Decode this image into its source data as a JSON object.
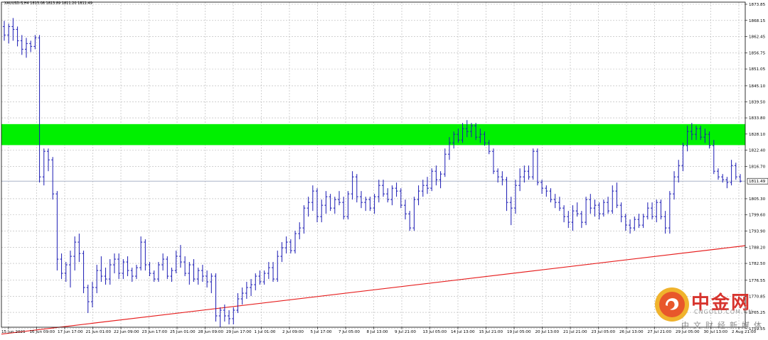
{
  "header": {
    "title": "XAUUSD-S,H4  1813.08 1813.89 1811.20 1811.49"
  },
  "watermark": {
    "brand_cn": "中金网",
    "domain": "CNGOLD.COM.CN",
    "subtitle_cn": "中文财经新媒体"
  },
  "chart_data": {
    "type": "candlestick",
    "symbol": "XAUUSD-S",
    "timeframe": "H4",
    "last_price": "1811.49",
    "y_axis": {
      "side": "right",
      "ylim": [
        1760.0,
        1874.6
      ],
      "tick_values": [
        1873.85,
        1868.15,
        1862.45,
        1856.75,
        1851.05,
        1845.1,
        1839.5,
        1833.8,
        1828.1,
        1822.4,
        1816.7,
        1811.49,
        1805.3,
        1799.6,
        1793.9,
        1788.2,
        1782.5,
        1776.55,
        1770.85,
        1765.25,
        1759.55
      ],
      "tick_labels": [
        "1873.85",
        "1868.15",
        "1862.45",
        "1856.75",
        "1851.05",
        "1845.10",
        "1839.50",
        "1833.80",
        "1828.10",
        "1822.40",
        "1816.70",
        "1811.49",
        "1805.30",
        "1799.60",
        "1793.90",
        "1788.20",
        "1782.50",
        "1776.55",
        "1770.85",
        "1765.25",
        "1759.55"
      ]
    },
    "x_axis": {
      "tick_labels": [
        "15 Jun 2021",
        "16 Jun 09:00",
        "17 Jun 17:00",
        "21 Jun 01:00",
        "22 Jun 09:00",
        "23 Jun 17:00",
        "25 Jun 01:00",
        "28 Jun 09:00",
        "29 Jun 17:00",
        "1 Jul 01:00",
        "2 Jul 09:00",
        "5 Jul 17:00",
        "7 Jul 05:00",
        "8 Jul 13:00",
        "9 Jul 21:00",
        "13 Jul 05:00",
        "14 Jul 13:00",
        "15 Jul 21:00",
        "19 Jul 05:00",
        "20 Jul 13:00",
        "21 Jul 21:00",
        "23 Jul 05:00",
        "26 Jul 13:00",
        "27 Jul 21:00",
        "29 Jul 05:00",
        "30 Jul 13:00",
        "2 Aug 21:00"
      ]
    },
    "grid": true,
    "colors": {
      "candle": "#1a1ab4",
      "grid": "#b4b4b4",
      "zone": "#00f000",
      "trendline": "#e61e1e",
      "price_line": "#aab4c8"
    },
    "resistance_zone": {
      "y_low": 1824.2,
      "y_high": 1831.6
    },
    "trendline": {
      "from": {
        "bar": 0,
        "y": 1757.7
      },
      "to": {
        "bar": 169,
        "y": 1788.9
      }
    },
    "candles": [
      {
        "o": 1866,
        "h": 1868,
        "l": 1861,
        "c": 1863
      },
      {
        "o": 1863,
        "h": 1867,
        "l": 1860,
        "c": 1866
      },
      {
        "o": 1866,
        "h": 1869,
        "l": 1861,
        "c": 1865
      },
      {
        "o": 1865,
        "h": 1866,
        "l": 1859,
        "c": 1861
      },
      {
        "o": 1861,
        "h": 1863,
        "l": 1856,
        "c": 1858
      },
      {
        "o": 1858,
        "h": 1862,
        "l": 1855,
        "c": 1860
      },
      {
        "o": 1860,
        "h": 1861,
        "l": 1857,
        "c": 1859
      },
      {
        "o": 1859,
        "h": 1863,
        "l": 1858,
        "c": 1862
      },
      {
        "o": 1862,
        "h": 1863,
        "l": 1811,
        "c": 1813
      },
      {
        "o": 1813,
        "h": 1823,
        "l": 1810,
        "c": 1822
      },
      {
        "o": 1822,
        "h": 1823,
        "l": 1815,
        "c": 1819
      },
      {
        "o": 1819,
        "h": 1820,
        "l": 1805,
        "c": 1807
      },
      {
        "o": 1807,
        "h": 1808,
        "l": 1780,
        "c": 1784
      },
      {
        "o": 1784,
        "h": 1786,
        "l": 1777,
        "c": 1779
      },
      {
        "o": 1779,
        "h": 1783,
        "l": 1776,
        "c": 1782
      },
      {
        "o": 1782,
        "h": 1787,
        "l": 1774,
        "c": 1785
      },
      {
        "o": 1785,
        "h": 1792,
        "l": 1780,
        "c": 1790
      },
      {
        "o": 1790,
        "h": 1793,
        "l": 1783,
        "c": 1786
      },
      {
        "o": 1786,
        "h": 1787,
        "l": 1772,
        "c": 1774
      },
      {
        "o": 1774,
        "h": 1775,
        "l": 1765,
        "c": 1769
      },
      {
        "o": 1769,
        "h": 1776,
        "l": 1767,
        "c": 1774
      },
      {
        "o": 1774,
        "h": 1782,
        "l": 1772,
        "c": 1780
      },
      {
        "o": 1780,
        "h": 1785,
        "l": 1776,
        "c": 1778
      },
      {
        "o": 1778,
        "h": 1781,
        "l": 1775,
        "c": 1777
      },
      {
        "o": 1777,
        "h": 1784,
        "l": 1775,
        "c": 1782
      },
      {
        "o": 1782,
        "h": 1786,
        "l": 1779,
        "c": 1784
      },
      {
        "o": 1784,
        "h": 1786,
        "l": 1777,
        "c": 1779
      },
      {
        "o": 1779,
        "h": 1784,
        "l": 1777,
        "c": 1783
      },
      {
        "o": 1783,
        "h": 1785,
        "l": 1778,
        "c": 1780
      },
      {
        "o": 1780,
        "h": 1781,
        "l": 1776,
        "c": 1778
      },
      {
        "o": 1778,
        "h": 1782,
        "l": 1777,
        "c": 1781
      },
      {
        "o": 1781,
        "h": 1792,
        "l": 1780,
        "c": 1790
      },
      {
        "o": 1790,
        "h": 1791,
        "l": 1780,
        "c": 1782
      },
      {
        "o": 1782,
        "h": 1783,
        "l": 1778,
        "c": 1779
      },
      {
        "o": 1779,
        "h": 1780,
        "l": 1776,
        "c": 1777
      },
      {
        "o": 1777,
        "h": 1783,
        "l": 1776,
        "c": 1782
      },
      {
        "o": 1782,
        "h": 1786,
        "l": 1780,
        "c": 1784
      },
      {
        "o": 1784,
        "h": 1785,
        "l": 1777,
        "c": 1778
      },
      {
        "o": 1778,
        "h": 1781,
        "l": 1776,
        "c": 1780
      },
      {
        "o": 1780,
        "h": 1787,
        "l": 1779,
        "c": 1785
      },
      {
        "o": 1785,
        "h": 1789,
        "l": 1781,
        "c": 1783
      },
      {
        "o": 1783,
        "h": 1785,
        "l": 1778,
        "c": 1779
      },
      {
        "o": 1779,
        "h": 1783,
        "l": 1775,
        "c": 1782
      },
      {
        "o": 1782,
        "h": 1784,
        "l": 1776,
        "c": 1777
      },
      {
        "o": 1777,
        "h": 1781,
        "l": 1775,
        "c": 1780
      },
      {
        "o": 1780,
        "h": 1782,
        "l": 1776,
        "c": 1778
      },
      {
        "o": 1778,
        "h": 1780,
        "l": 1774,
        "c": 1776
      },
      {
        "o": 1776,
        "h": 1779,
        "l": 1772,
        "c": 1778
      },
      {
        "o": 1778,
        "h": 1779,
        "l": 1762,
        "c": 1764
      },
      {
        "o": 1764,
        "h": 1767,
        "l": 1760,
        "c": 1766
      },
      {
        "o": 1766,
        "h": 1768,
        "l": 1762,
        "c": 1764
      },
      {
        "o": 1764,
        "h": 1766,
        "l": 1761,
        "c": 1763
      },
      {
        "o": 1763,
        "h": 1767,
        "l": 1761,
        "c": 1766
      },
      {
        "o": 1766,
        "h": 1772,
        "l": 1765,
        "c": 1770
      },
      {
        "o": 1770,
        "h": 1774,
        "l": 1768,
        "c": 1772
      },
      {
        "o": 1772,
        "h": 1776,
        "l": 1770,
        "c": 1774
      },
      {
        "o": 1774,
        "h": 1777,
        "l": 1771,
        "c": 1775
      },
      {
        "o": 1775,
        "h": 1779,
        "l": 1773,
        "c": 1778
      },
      {
        "o": 1778,
        "h": 1780,
        "l": 1775,
        "c": 1776
      },
      {
        "o": 1776,
        "h": 1780,
        "l": 1775,
        "c": 1779
      },
      {
        "o": 1779,
        "h": 1783,
        "l": 1777,
        "c": 1781
      },
      {
        "o": 1781,
        "h": 1783,
        "l": 1776,
        "c": 1777
      },
      {
        "o": 1777,
        "h": 1787,
        "l": 1776,
        "c": 1785
      },
      {
        "o": 1785,
        "h": 1790,
        "l": 1783,
        "c": 1788
      },
      {
        "o": 1788,
        "h": 1792,
        "l": 1786,
        "c": 1790
      },
      {
        "o": 1790,
        "h": 1791,
        "l": 1786,
        "c": 1787
      },
      {
        "o": 1787,
        "h": 1794,
        "l": 1786,
        "c": 1793
      },
      {
        "o": 1793,
        "h": 1797,
        "l": 1791,
        "c": 1795
      },
      {
        "o": 1795,
        "h": 1803,
        "l": 1793,
        "c": 1802
      },
      {
        "o": 1802,
        "h": 1806,
        "l": 1799,
        "c": 1804
      },
      {
        "o": 1804,
        "h": 1810,
        "l": 1801,
        "c": 1808
      },
      {
        "o": 1808,
        "h": 1809,
        "l": 1797,
        "c": 1799
      },
      {
        "o": 1799,
        "h": 1805,
        "l": 1797,
        "c": 1803
      },
      {
        "o": 1803,
        "h": 1808,
        "l": 1800,
        "c": 1806
      },
      {
        "o": 1806,
        "h": 1807,
        "l": 1801,
        "c": 1802
      },
      {
        "o": 1802,
        "h": 1806,
        "l": 1800,
        "c": 1805
      },
      {
        "o": 1805,
        "h": 1808,
        "l": 1803,
        "c": 1804
      },
      {
        "o": 1804,
        "h": 1806,
        "l": 1798,
        "c": 1799
      },
      {
        "o": 1799,
        "h": 1808,
        "l": 1798,
        "c": 1807
      },
      {
        "o": 1807,
        "h": 1815,
        "l": 1805,
        "c": 1813
      },
      {
        "o": 1813,
        "h": 1814,
        "l": 1804,
        "c": 1806
      },
      {
        "o": 1806,
        "h": 1808,
        "l": 1802,
        "c": 1804
      },
      {
        "o": 1804,
        "h": 1806,
        "l": 1801,
        "c": 1805
      },
      {
        "o": 1805,
        "h": 1806,
        "l": 1801,
        "c": 1802
      },
      {
        "o": 1802,
        "h": 1807,
        "l": 1800,
        "c": 1806
      },
      {
        "o": 1806,
        "h": 1812,
        "l": 1804,
        "c": 1810
      },
      {
        "o": 1810,
        "h": 1812,
        "l": 1806,
        "c": 1807
      },
      {
        "o": 1807,
        "h": 1809,
        "l": 1804,
        "c": 1805
      },
      {
        "o": 1805,
        "h": 1810,
        "l": 1803,
        "c": 1809
      },
      {
        "o": 1809,
        "h": 1811,
        "l": 1806,
        "c": 1808
      },
      {
        "o": 1808,
        "h": 1809,
        "l": 1802,
        "c": 1803
      },
      {
        "o": 1803,
        "h": 1805,
        "l": 1798,
        "c": 1800
      },
      {
        "o": 1800,
        "h": 1801,
        "l": 1794,
        "c": 1795
      },
      {
        "o": 1795,
        "h": 1806,
        "l": 1794,
        "c": 1805
      },
      {
        "o": 1805,
        "h": 1810,
        "l": 1803,
        "c": 1808
      },
      {
        "o": 1808,
        "h": 1812,
        "l": 1806,
        "c": 1810
      },
      {
        "o": 1810,
        "h": 1813,
        "l": 1807,
        "c": 1809
      },
      {
        "o": 1809,
        "h": 1816,
        "l": 1808,
        "c": 1815
      },
      {
        "o": 1815,
        "h": 1817,
        "l": 1810,
        "c": 1812
      },
      {
        "o": 1812,
        "h": 1815,
        "l": 1809,
        "c": 1814
      },
      {
        "o": 1814,
        "h": 1823,
        "l": 1813,
        "c": 1821
      },
      {
        "o": 1821,
        "h": 1827,
        "l": 1819,
        "c": 1825
      },
      {
        "o": 1825,
        "h": 1829,
        "l": 1823,
        "c": 1828
      },
      {
        "o": 1828,
        "h": 1830,
        "l": 1825,
        "c": 1826
      },
      {
        "o": 1826,
        "h": 1832,
        "l": 1825,
        "c": 1830
      },
      {
        "o": 1830,
        "h": 1833,
        "l": 1827,
        "c": 1829
      },
      {
        "o": 1829,
        "h": 1832,
        "l": 1827,
        "c": 1831
      },
      {
        "o": 1831,
        "h": 1832,
        "l": 1826,
        "c": 1827
      },
      {
        "o": 1827,
        "h": 1830,
        "l": 1825,
        "c": 1828
      },
      {
        "o": 1828,
        "h": 1829,
        "l": 1824,
        "c": 1825
      },
      {
        "o": 1825,
        "h": 1826,
        "l": 1821,
        "c": 1822
      },
      {
        "o": 1822,
        "h": 1823,
        "l": 1814,
        "c": 1815
      },
      {
        "o": 1815,
        "h": 1816,
        "l": 1811,
        "c": 1813
      },
      {
        "o": 1813,
        "h": 1815,
        "l": 1810,
        "c": 1812
      },
      {
        "o": 1812,
        "h": 1813,
        "l": 1801,
        "c": 1804
      },
      {
        "o": 1804,
        "h": 1806,
        "l": 1796,
        "c": 1802
      },
      {
        "o": 1802,
        "h": 1812,
        "l": 1800,
        "c": 1810
      },
      {
        "o": 1810,
        "h": 1816,
        "l": 1808,
        "c": 1813
      },
      {
        "o": 1813,
        "h": 1817,
        "l": 1811,
        "c": 1815
      },
      {
        "o": 1815,
        "h": 1817,
        "l": 1812,
        "c": 1813
      },
      {
        "o": 1813,
        "h": 1823,
        "l": 1812,
        "c": 1822
      },
      {
        "o": 1822,
        "h": 1823,
        "l": 1810,
        "c": 1811
      },
      {
        "o": 1811,
        "h": 1812,
        "l": 1807,
        "c": 1809
      },
      {
        "o": 1809,
        "h": 1810,
        "l": 1806,
        "c": 1808
      },
      {
        "o": 1808,
        "h": 1809,
        "l": 1804,
        "c": 1805
      },
      {
        "o": 1805,
        "h": 1807,
        "l": 1802,
        "c": 1804
      },
      {
        "o": 1804,
        "h": 1806,
        "l": 1801,
        "c": 1802
      },
      {
        "o": 1802,
        "h": 1803,
        "l": 1797,
        "c": 1799
      },
      {
        "o": 1799,
        "h": 1801,
        "l": 1795,
        "c": 1797
      },
      {
        "o": 1797,
        "h": 1803,
        "l": 1794,
        "c": 1801
      },
      {
        "o": 1801,
        "h": 1804,
        "l": 1799,
        "c": 1800
      },
      {
        "o": 1800,
        "h": 1801,
        "l": 1795,
        "c": 1797
      },
      {
        "o": 1797,
        "h": 1806,
        "l": 1796,
        "c": 1805
      },
      {
        "o": 1805,
        "h": 1807,
        "l": 1800,
        "c": 1802
      },
      {
        "o": 1802,
        "h": 1805,
        "l": 1799,
        "c": 1803
      },
      {
        "o": 1803,
        "h": 1804,
        "l": 1798,
        "c": 1800
      },
      {
        "o": 1800,
        "h": 1805,
        "l": 1799,
        "c": 1804
      },
      {
        "o": 1804,
        "h": 1806,
        "l": 1800,
        "c": 1801
      },
      {
        "o": 1801,
        "h": 1810,
        "l": 1800,
        "c": 1808
      },
      {
        "o": 1808,
        "h": 1811,
        "l": 1802,
        "c": 1803
      },
      {
        "o": 1803,
        "h": 1804,
        "l": 1797,
        "c": 1799
      },
      {
        "o": 1799,
        "h": 1800,
        "l": 1794,
        "c": 1796
      },
      {
        "o": 1796,
        "h": 1798,
        "l": 1793,
        "c": 1795
      },
      {
        "o": 1795,
        "h": 1799,
        "l": 1794,
        "c": 1798
      },
      {
        "o": 1798,
        "h": 1800,
        "l": 1795,
        "c": 1796
      },
      {
        "o": 1796,
        "h": 1800,
        "l": 1795,
        "c": 1799
      },
      {
        "o": 1799,
        "h": 1804,
        "l": 1798,
        "c": 1802
      },
      {
        "o": 1802,
        "h": 1804,
        "l": 1798,
        "c": 1799
      },
      {
        "o": 1799,
        "h": 1805,
        "l": 1797,
        "c": 1804
      },
      {
        "o": 1804,
        "h": 1805,
        "l": 1798,
        "c": 1799
      },
      {
        "o": 1799,
        "h": 1801,
        "l": 1793,
        "c": 1795
      },
      {
        "o": 1795,
        "h": 1808,
        "l": 1793,
        "c": 1807
      },
      {
        "o": 1807,
        "h": 1815,
        "l": 1805,
        "c": 1813
      },
      {
        "o": 1813,
        "h": 1819,
        "l": 1811,
        "c": 1817
      },
      {
        "o": 1817,
        "h": 1825,
        "l": 1815,
        "c": 1824
      },
      {
        "o": 1824,
        "h": 1831,
        "l": 1822,
        "c": 1829
      },
      {
        "o": 1829,
        "h": 1832,
        "l": 1826,
        "c": 1828
      },
      {
        "o": 1828,
        "h": 1831,
        "l": 1826,
        "c": 1830
      },
      {
        "o": 1830,
        "h": 1831,
        "l": 1826,
        "c": 1827
      },
      {
        "o": 1827,
        "h": 1830,
        "l": 1825,
        "c": 1828
      },
      {
        "o": 1828,
        "h": 1829,
        "l": 1823,
        "c": 1824
      },
      {
        "o": 1824,
        "h": 1826,
        "l": 1814,
        "c": 1815
      },
      {
        "o": 1815,
        "h": 1816,
        "l": 1812,
        "c": 1813
      },
      {
        "o": 1813,
        "h": 1814,
        "l": 1811,
        "c": 1812
      },
      {
        "o": 1812,
        "h": 1813,
        "l": 1809,
        "c": 1811
      },
      {
        "o": 1811,
        "h": 1819,
        "l": 1810,
        "c": 1817
      },
      {
        "o": 1817,
        "h": 1818,
        "l": 1812,
        "c": 1813
      },
      {
        "o": 1813,
        "h": 1814,
        "l": 1811,
        "c": 1811.49
      }
    ]
  }
}
